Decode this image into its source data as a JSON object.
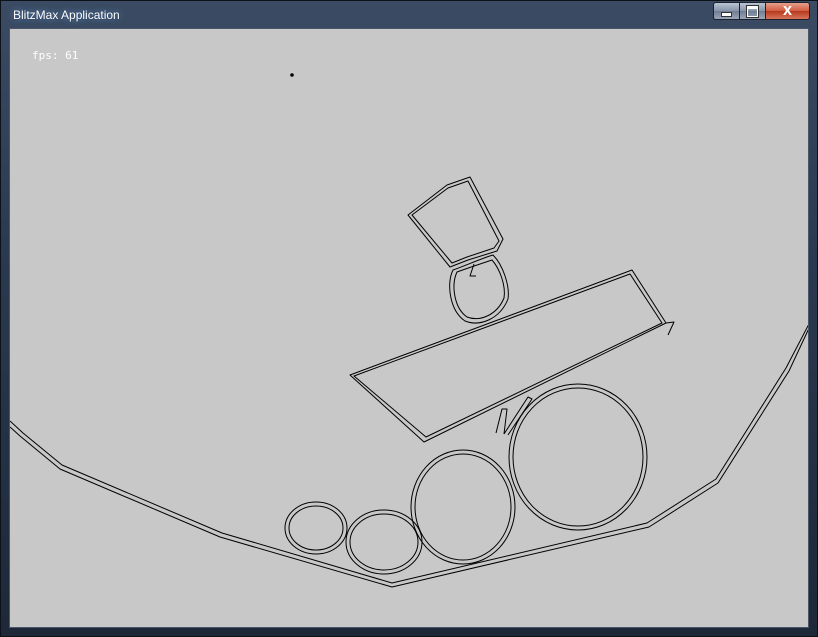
{
  "window": {
    "title": "BlitzMax Application",
    "controls": {
      "minimize_icon": "minimize-icon",
      "maximize_icon": "maximize-icon",
      "close_label": "X"
    }
  },
  "canvas": {
    "background_color": "#c8c8c8",
    "line_color": "#000000",
    "fps_label": "fps: 61"
  }
}
